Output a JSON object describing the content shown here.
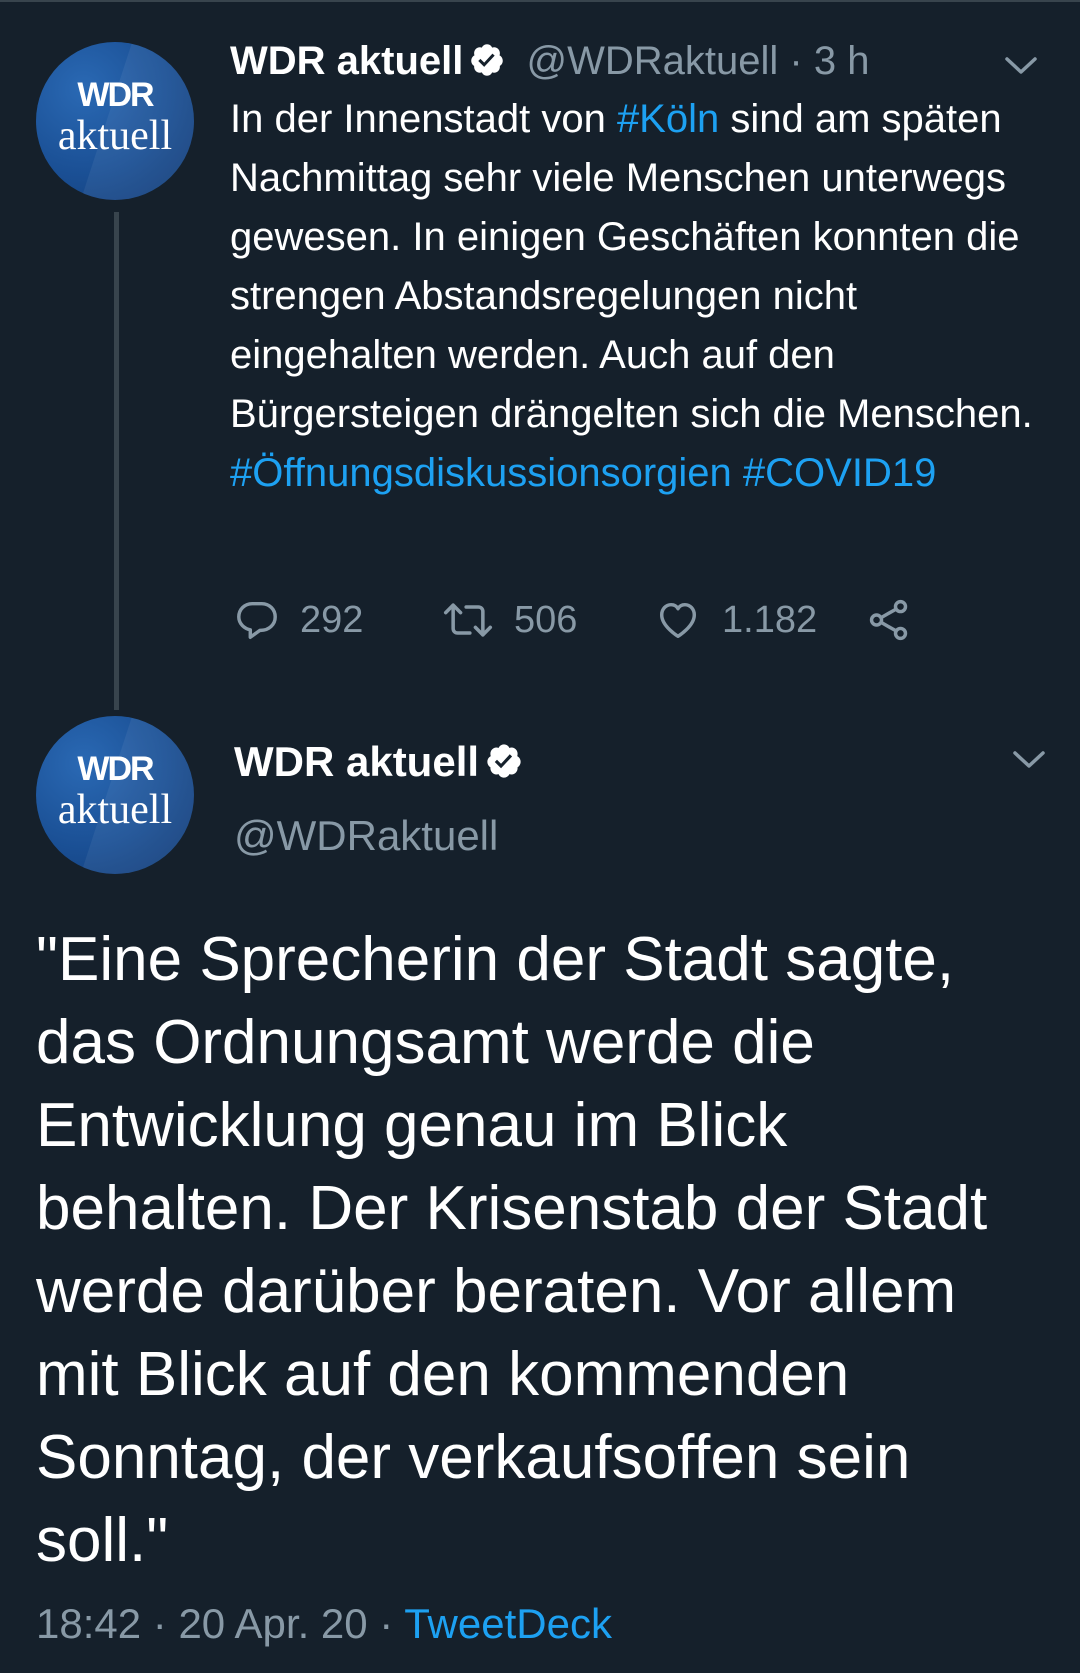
{
  "tweet1": {
    "avatar": {
      "logo_top": "WDR",
      "logo_bottom": "aktuell"
    },
    "display_name": "WDR aktuell",
    "handle": "@WDRaktuell",
    "separator": "·",
    "time": "3 h",
    "text_1": "In der Innenstadt von ",
    "hashtag_koeln": "#Köln",
    "text_2": " sind am späten Nachmittag sehr viele Menschen unterwegs gewesen. In einigen Geschäften konnten die strengen Abstandsregelungen nicht eingehalten werden. Auch auf den Bürgersteigen drängelten sich die Menschen.",
    "hashtag_1": "#Öffnungsdiskussionsorgien",
    "hashtag_2": "#COVID19",
    "replies": "292",
    "retweets": "506",
    "likes": "1.182"
  },
  "tweet2": {
    "avatar": {
      "logo_top": "WDR",
      "logo_bottom": "aktuell"
    },
    "display_name": "WDR aktuell",
    "handle": "@WDRaktuell",
    "text": "\"Eine Sprecherin der Stadt sagte, das Ordnungsamt werde die Entwicklung genau im Blick behalten. Der Krisenstab der Stadt werde darüber beraten. Vor allem mit Blick auf den kommenden Sonntag, der verkaufsoffen sein soll.\"",
    "time": "18:42",
    "date": "20 Apr. 20",
    "separator": "·",
    "source": "TweetDeck"
  },
  "colors": {
    "background": "#15202b",
    "muted": "#8899a6",
    "link": "#1da1f2",
    "avatar": "#1a4f94"
  },
  "icons": [
    "verified-badge-icon",
    "chevron-down-icon",
    "reply-icon",
    "retweet-icon",
    "like-icon",
    "share-icon"
  ]
}
